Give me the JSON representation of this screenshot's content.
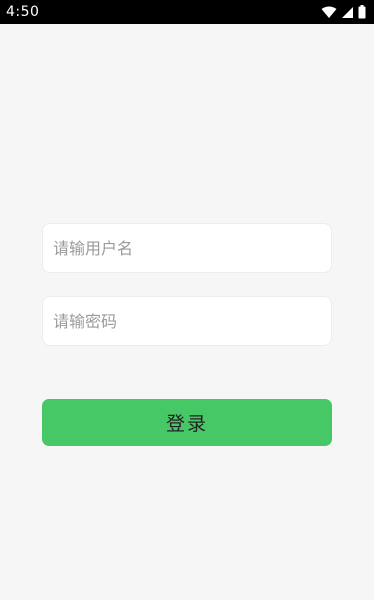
{
  "status_bar": {
    "time": "4:50",
    "icons": [
      "wifi-icon",
      "signal-icon",
      "battery-icon"
    ]
  },
  "login_form": {
    "username_placeholder": "请输用户名",
    "password_placeholder": "请输密码",
    "login_label": "登录"
  },
  "colors": {
    "background": "#f6f6f6",
    "status_bar": "#000000",
    "button": "#47c867"
  }
}
